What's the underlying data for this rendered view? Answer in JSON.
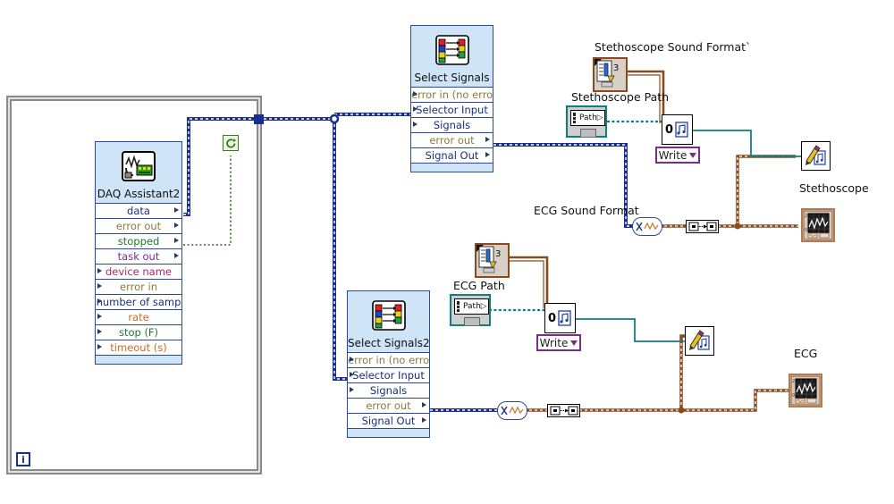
{
  "app": {
    "title": "LabVIEW Block Diagram",
    "canvas_background": "#ffffff"
  },
  "colors": {
    "express_fill": "#cfe4f7",
    "express_border": "#2b4a9b",
    "loop_border": "#8a8a8a",
    "dynamic_wire": "#1a2f8a",
    "waveform_wire": "#8a4a1e",
    "path_wire": "#0e7f80",
    "error_wire": "#8a7a3d",
    "stop_terminal": "#3b7a1e",
    "select_ring": "#7a2e8a",
    "graph_terminal": "#b07a52"
  },
  "while_loop": {
    "name": "while-loop",
    "iteration_label": "i",
    "stop_terminal_icon": "stop-loop-icon"
  },
  "nodes": {
    "daq_assistant": {
      "title": "DAQ Assistant2",
      "icon": "daq-assistant-icon",
      "terminals": [
        {
          "label": "data",
          "side": "out",
          "color": "blue"
        },
        {
          "label": "error out",
          "side": "out",
          "color": "error"
        },
        {
          "label": "stopped",
          "side": "out",
          "color": "green"
        },
        {
          "label": "task out",
          "side": "out",
          "color": "purple"
        },
        {
          "label": "device name",
          "side": "in",
          "color": "magenta"
        },
        {
          "label": "error in",
          "side": "in",
          "color": "error"
        },
        {
          "label": "number of samp",
          "side": "in",
          "color": "blue"
        },
        {
          "label": "rate",
          "side": "in",
          "color": "orange"
        },
        {
          "label": "stop (F)",
          "side": "in",
          "color": "green"
        },
        {
          "label": "timeout (s)",
          "side": "in",
          "color": "orange"
        }
      ]
    },
    "select_signals_1": {
      "title": "Select Signals",
      "icon": "select-signals-icon",
      "terminals": [
        {
          "label": "error in (no error",
          "side": "in",
          "color": "error"
        },
        {
          "label": "Selector Input",
          "side": "in",
          "color": "blue"
        },
        {
          "label": "Signals",
          "side": "in",
          "color": "blue"
        },
        {
          "label": "error out",
          "side": "out",
          "color": "error"
        },
        {
          "label": "Signal Out",
          "side": "out",
          "color": "blue"
        }
      ]
    },
    "select_signals_2": {
      "title": "Select Signals2",
      "icon": "select-signals-icon",
      "terminals": [
        {
          "label": "error in (no error",
          "side": "in",
          "color": "error"
        },
        {
          "label": "Selector Input",
          "side": "in",
          "color": "blue"
        },
        {
          "label": "Signals",
          "side": "in",
          "color": "blue"
        },
        {
          "label": "error out",
          "side": "out",
          "color": "error"
        },
        {
          "label": "Signal Out",
          "side": "out",
          "color": "blue"
        }
      ]
    }
  },
  "labels": {
    "stethoscope_sound_format": "Stethoscope Sound Format`",
    "stethoscope_path": "Stethoscope Path",
    "ecg_sound_format": "ECG Sound Format",
    "ecg_path": "ECG Path",
    "stethoscope_graph": "Stethoscope",
    "ecg_graph": "ECG"
  },
  "controls": {
    "stethoscope_path_value": "Path",
    "ecg_path_value": "Path",
    "sound_format_cluster_count": "3"
  },
  "sound_file_write_top": {
    "mode_label": "Write",
    "refnum_label": "0",
    "icon": "sound-file-write-icon"
  },
  "sound_file_write_bottom": {
    "mode_label": "Write",
    "refnum_label": "0",
    "icon": "sound-file-write-icon"
  },
  "write_sound_nodes": {
    "stethoscope": {
      "icon": "sound-write-pencil-icon"
    },
    "ecg": {
      "icon": "sound-write-pencil-icon"
    }
  },
  "convert_nodes": {
    "top": [
      {
        "icon": "from-dynamic-data-icon"
      },
      {
        "icon": "waveform-to-array-icon"
      }
    ],
    "bottom": [
      {
        "icon": "from-dynamic-data-icon"
      },
      {
        "icon": "waveform-to-array-icon"
      }
    ]
  }
}
